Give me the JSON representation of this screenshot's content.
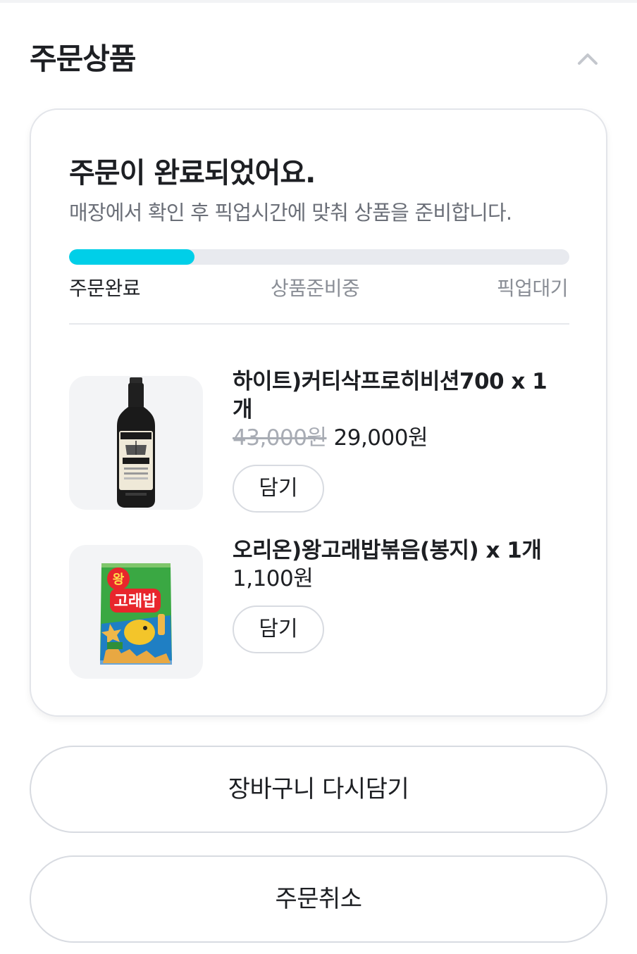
{
  "section": {
    "title": "주문상품",
    "collapse_icon": "chevron-up-icon"
  },
  "status": {
    "title": "주문이 완료되었어요.",
    "description": "매장에서 확인 후 픽업시간에 맞춰 상품을 준비합니다.",
    "progress_fraction": 0.25,
    "accent_color": "#00cfe8",
    "steps": [
      {
        "label": "주문완료",
        "active": true
      },
      {
        "label": "상품준비중",
        "active": false
      },
      {
        "label": "픽업대기",
        "active": false
      }
    ]
  },
  "products": [
    {
      "name": "하이트)커티삭프로히비션700 x 1개",
      "original_price": "43,000원",
      "price": "29,000원",
      "add_label": "담기",
      "image_icon": "whisky-bottle-image"
    },
    {
      "name": "오리온)왕고래밥볶음(봉지) x 1개",
      "original_price": "",
      "price": "1,100원",
      "add_label": "담기",
      "image_icon": "snack-bag-image"
    }
  ],
  "actions": {
    "recart_label": "장바구니 다시담기",
    "cancel_label": "주문취소"
  }
}
